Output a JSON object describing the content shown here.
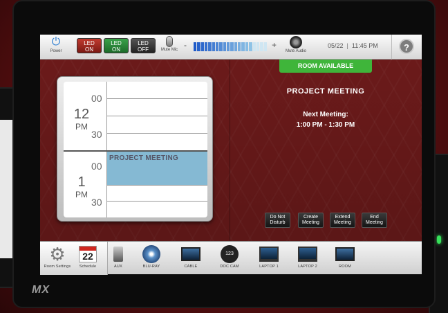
{
  "topbar": {
    "power_label": "Power",
    "led_buttons": [
      {
        "line1": "LED",
        "line2": "ON",
        "color": "#a8261f"
      },
      {
        "line1": "LED",
        "line2": "ON",
        "color": "#2e8a3b"
      },
      {
        "line1": "LED",
        "line2": "OFF",
        "color": "#333333"
      }
    ],
    "mute_mic_label": "Mute Mic",
    "vol_minus": "-",
    "vol_plus": "+",
    "volume_level": 0.8,
    "mute_audio_label": "Mute Audio",
    "date": "05/22",
    "time": "11:45 PM",
    "help_glyph": "?"
  },
  "schedule": {
    "hours": [
      {
        "num": "12",
        "ampm": "PM"
      },
      {
        "num": "1",
        "ampm": "PM"
      }
    ],
    "minute_marks": [
      "00",
      "30",
      "00",
      "30"
    ],
    "booked_title": "PROJECT MEETING"
  },
  "room": {
    "status": "ROOM AVAILABLE",
    "status_color": "#3fb53a",
    "meeting_title": "PROJECT MEETING",
    "next_label": "Next Meeting:",
    "next_time": "1:00 PM - 1:30 PM"
  },
  "actions": {
    "do_not_disturb": {
      "line1": "Do Not",
      "line2": "Disturb"
    },
    "create_meeting": {
      "line1": "Create",
      "line2": "Meeting"
    },
    "extend_meeting": {
      "line1": "Extend",
      "line2": "Meeting"
    },
    "end_meeting": {
      "line1": "End",
      "line2": "Meeting"
    }
  },
  "bottombar": {
    "room_settings_label": "Room Settings",
    "schedule_label": "Schedule",
    "calendar_day": "22",
    "sources": [
      {
        "label": "AUX",
        "icon": "aux-icon"
      },
      {
        "label": "BLU-RAY",
        "icon": "bluray-icon"
      },
      {
        "label": "CABLE",
        "icon": "cable-icon"
      },
      {
        "label": "DOC CAM",
        "icon": "doccam-icon"
      },
      {
        "label": "LAPTOP 1",
        "icon": "laptop-icon"
      },
      {
        "label": "LAPTOP 2",
        "icon": "laptop-icon"
      },
      {
        "label": "ROOM",
        "icon": "monitor-icon"
      }
    ],
    "doccam_number": "123"
  },
  "brand": "MX"
}
